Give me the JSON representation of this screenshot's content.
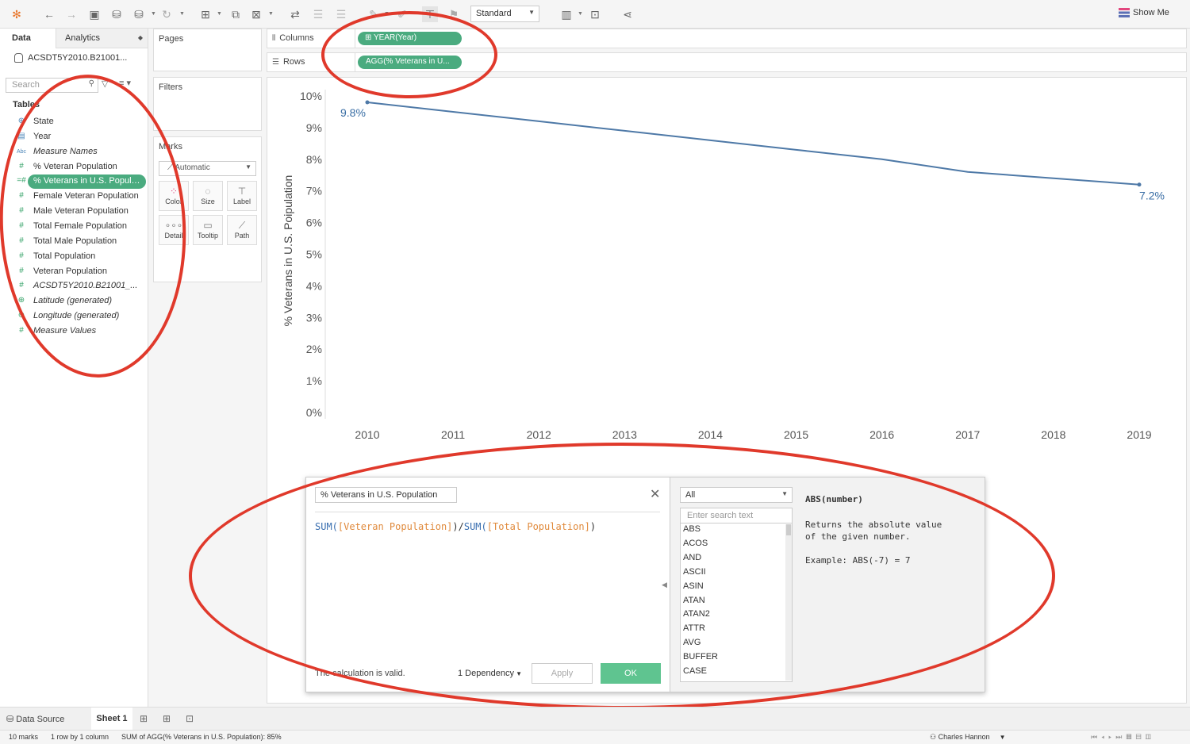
{
  "toolbar": {
    "fit_select": "Standard",
    "show_me": "Show Me"
  },
  "data_pane": {
    "tab_data": "Data",
    "tab_analytics": "Analytics",
    "datasource": "ACSDT5Y2010.B21001...",
    "search_placeholder": "Search",
    "tables_header": "Tables",
    "fields": [
      {
        "icon": "⊕",
        "label": "State"
      },
      {
        "icon": "▤",
        "label": "Year"
      },
      {
        "icon": "Abc",
        "label": "Measure Names"
      },
      {
        "icon": "#",
        "label": "% Veteran Population"
      },
      {
        "icon": "=#",
        "label": "% Veterans in U.S. Populat..."
      },
      {
        "icon": "#",
        "label": "Female Veteran Population"
      },
      {
        "icon": "#",
        "label": "Male Veteran Population"
      },
      {
        "icon": "#",
        "label": "Total Female Population"
      },
      {
        "icon": "#",
        "label": "Total Male Population"
      },
      {
        "icon": "#",
        "label": "Total Population"
      },
      {
        "icon": "#",
        "label": "Veteran Population"
      },
      {
        "icon": "#",
        "label": "ACSDT5Y2010.B21001_..."
      },
      {
        "icon": "⊕",
        "label": "Latitude (generated)"
      },
      {
        "icon": "⊕",
        "label": "Longitude (generated)"
      },
      {
        "icon": "#",
        "label": "Measure Values"
      }
    ]
  },
  "cards": {
    "pages": "Pages",
    "filters": "Filters",
    "marks": "Marks",
    "marks_type": "Automatic",
    "mark_buttons": [
      "Color",
      "Size",
      "Label",
      "Detail",
      "Tooltip",
      "Path"
    ]
  },
  "shelves": {
    "columns_label": "Columns",
    "columns_pill": "YEAR(Year)",
    "rows_label": "Rows",
    "rows_pill": "AGG(% Veterans in U..."
  },
  "chart_data": {
    "type": "line",
    "x": [
      2010,
      2011,
      2012,
      2013,
      2014,
      2015,
      2016,
      2017,
      2018,
      2019
    ],
    "series": [
      {
        "name": "% Veterans in U.S. Poipulation",
        "values": [
          9.8,
          9.5,
          9.2,
          8.9,
          8.6,
          8.3,
          8.0,
          7.6,
          7.4,
          7.2
        ]
      }
    ],
    "ylabel": "% Veterans in U.S. Poipulation",
    "xlabel": "",
    "ylim": [
      0,
      10
    ],
    "yticks": [
      "0%",
      "1%",
      "2%",
      "3%",
      "4%",
      "5%",
      "6%",
      "7%",
      "8%",
      "9%",
      "10%"
    ],
    "data_labels": [
      {
        "x": 2010,
        "text": "9.8%"
      },
      {
        "x": 2019,
        "text": "7.2%"
      }
    ],
    "line_color": "#4e79a7"
  },
  "calc_editor": {
    "name": "% Veterans in U.S. Population",
    "formula_parts": {
      "fn1": "SUM(",
      "field1": "[Veteran Population]",
      "mid": ")/",
      "fn2": "SUM(",
      "field2": "[Total Population]",
      "end": ")"
    },
    "status": "The calculation is valid.",
    "dependency": "1 Dependency",
    "apply": "Apply",
    "ok": "OK",
    "category": "All",
    "search_placeholder": "Enter search text",
    "functions": [
      "ABS",
      "ACOS",
      "AND",
      "ASCII",
      "ASIN",
      "ATAN",
      "ATAN2",
      "ATTR",
      "AVG",
      "BUFFER",
      "CASE"
    ],
    "signature": "ABS(number)",
    "description": "Returns the absolute value\nof the given number.",
    "example": "Example: ABS(-7) = 7"
  },
  "bottom": {
    "data_source_tab": "Data Source",
    "sheet_tab": "Sheet 1",
    "status_marks": "10 marks",
    "status_rows": "1 row by 1 column",
    "status_sum": "SUM of AGG(% Veterans in U.S. Population): 85%",
    "user": "Charles Hannon"
  }
}
